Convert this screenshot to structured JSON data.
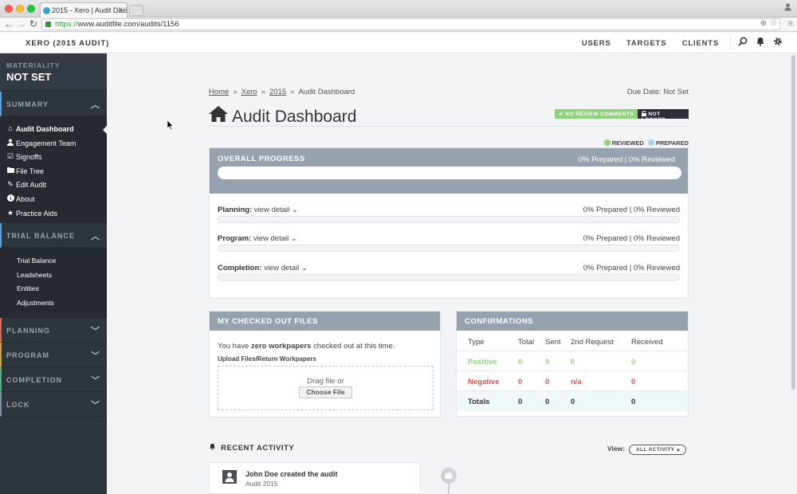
{
  "browser": {
    "tab_title": "2015 - Xero | Audit Dashb",
    "url_https": "https://",
    "url_rest": "www.auditfile.com/audits/1156",
    "colors": {
      "lock": "#2d9c3b",
      "menu": "#e07a1f"
    }
  },
  "header": {
    "app_title": "XERO (2015 AUDIT)",
    "nav": [
      "USERS",
      "TARGETS",
      "CLIENTS"
    ]
  },
  "sidebar": {
    "materiality_label": "MATERIALITY",
    "materiality_value": "NOT SET",
    "summary_title": "SUMMARY",
    "summary_items": [
      {
        "label": "Audit Dashboard",
        "icon": "home-icon"
      },
      {
        "label": "Engagement Team",
        "icon": "user-icon"
      },
      {
        "label": "Signoffs",
        "icon": "edit-icon"
      },
      {
        "label": "File Tree",
        "icon": "folder-icon"
      },
      {
        "label": "Edit Audit",
        "icon": "pencil-icon"
      },
      {
        "label": "About",
        "icon": "info-icon"
      },
      {
        "label": "Practice Aids",
        "icon": "star-icon"
      }
    ],
    "trial_balance_title": "TRIAL BALANCE",
    "trial_balance_items": [
      "Trial Balance",
      "Leadsheets",
      "Entities",
      "Adjustments"
    ],
    "planning_title": "PLANNING",
    "program_title": "PROGRAM",
    "completion_title": "COMPLETION",
    "lock_title": "LOCK"
  },
  "breadcrumb": {
    "home": "Home",
    "client": "Xero",
    "year": "2015",
    "current": "Audit Dashboard"
  },
  "due_date": "Due Date: Not Set",
  "page_title": "Audit Dashboard",
  "badges": {
    "review": "NO REVIEW COMMENTS",
    "lock": "NOT LOCKED"
  },
  "legend": {
    "reviewed": "REVIEWED",
    "prepared": "PREPARED"
  },
  "overall_progress": {
    "title": "OVERALL PROGRESS",
    "stat": "0% Prepared | 0% Reviewed",
    "progress": 0,
    "rows": [
      {
        "label": "Planning:",
        "link": "view detail",
        "stat": "0% Prepared | 0% Reviewed",
        "progress": 0
      },
      {
        "label": "Program:",
        "link": "view detail",
        "stat": "0% Prepared | 0% Reviewed",
        "progress": 0
      },
      {
        "label": "Completion:",
        "link": "view detail",
        "stat": "0% Prepared | 0% Reviewed",
        "progress": 0
      }
    ]
  },
  "checked_out": {
    "title": "MY CHECKED OUT FILES",
    "msg_pre": "You have ",
    "msg_bold": "zero workpapers",
    "msg_post": " checked out at this time.",
    "upload_label": "Upload Files/Return Workpapers",
    "drag_text": "Drag file or",
    "choose_button": "Choose File"
  },
  "confirmations": {
    "title": "CONFIRMATIONS",
    "headers": [
      "Type",
      "Total",
      "Sent",
      "2nd Request",
      "Received"
    ],
    "rows": [
      [
        "Positive",
        "0",
        "0",
        "0",
        "0"
      ],
      [
        "Negative",
        "0",
        "0",
        "n/a",
        "0"
      ],
      [
        "Totals",
        "0",
        "0",
        "0",
        "0"
      ]
    ],
    "colors": {
      "positive": "#8fd37a",
      "negative": "#d9534f"
    }
  },
  "activity": {
    "title": "RECENT ACTIVITY",
    "view_label": "View:",
    "view_value": "ALL ACTIVITY",
    "item_title": "John Doe created the audit",
    "item_sub": "Audit 2015"
  }
}
